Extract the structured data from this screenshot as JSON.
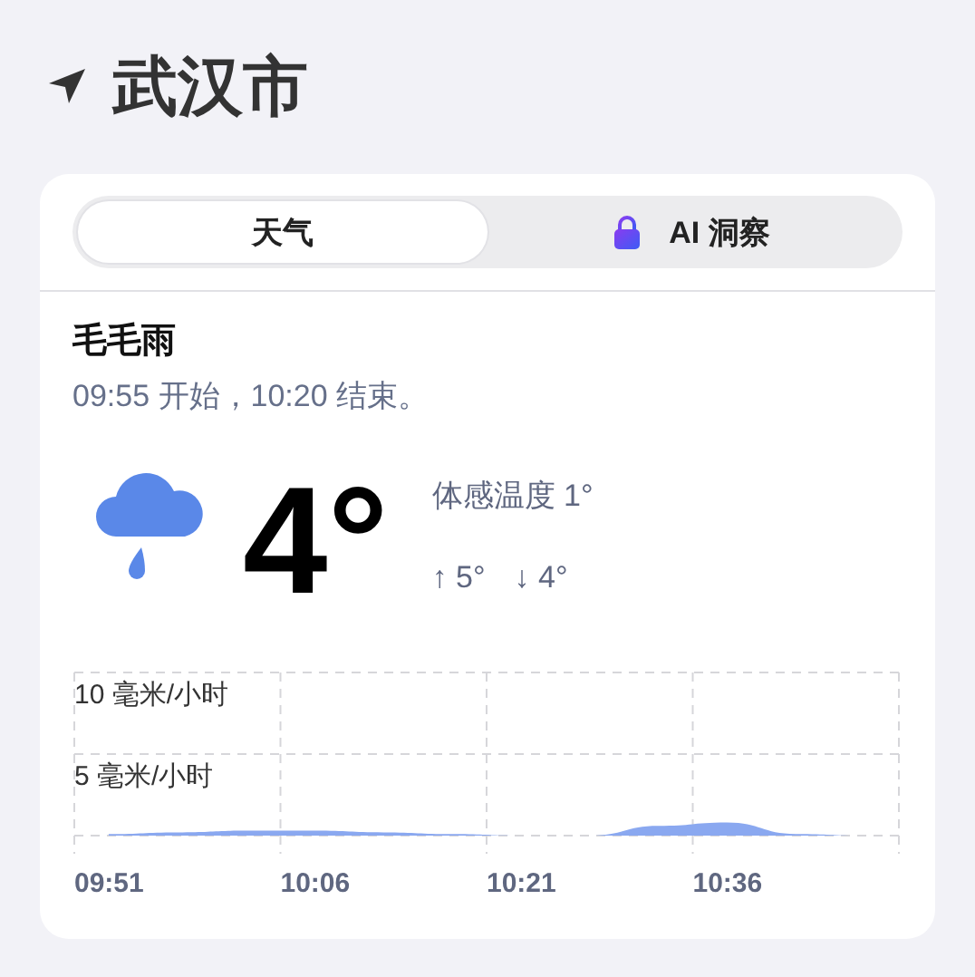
{
  "location": {
    "title": "武汉市"
  },
  "tabs": [
    {
      "label": "天气",
      "selected": true,
      "locked": false
    },
    {
      "label": "AI 洞察",
      "selected": false,
      "locked": true
    }
  ],
  "summary": {
    "condition": "毛毛雨",
    "timing": "09:55 开始，10:20 结束。"
  },
  "current": {
    "temperature": "4°",
    "feels_like": "体感温度 1°",
    "high": "↑ 5°",
    "low": "↓ 4°"
  },
  "precipitation": {
    "chart_data": {
      "type": "area",
      "categories": [
        "09:51",
        null,
        null,
        "10:06",
        null,
        null,
        "10:21",
        null,
        null,
        "10:36",
        null,
        null
      ],
      "series": [
        {
          "color": "#8aa8f0",
          "values": [
            0.1,
            0.2,
            0.3,
            0.3,
            0.2,
            0.1,
            0,
            0,
            0.6,
            0.8,
            0.1,
            0
          ]
        }
      ],
      "ylim": [
        0,
        10
      ],
      "yticks": [
        {
          "value": 10,
          "label": "10 毫米/小时"
        },
        {
          "value": 5,
          "label": "5 毫米/小时"
        }
      ]
    }
  }
}
